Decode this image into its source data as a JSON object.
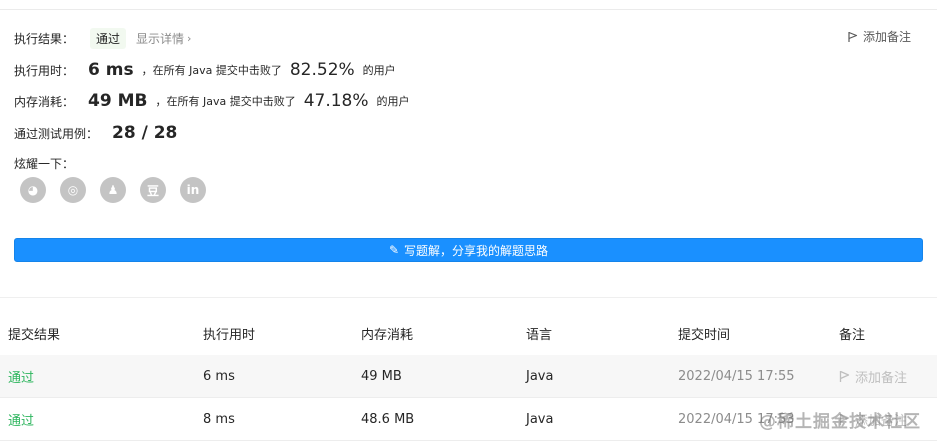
{
  "result": {
    "label": "执行结果：",
    "status": "通过",
    "details_link": "显示详情",
    "add_note": "添加备注"
  },
  "runtime": {
    "label": "执行用时：",
    "value": "6 ms",
    "prefix": "，在所有 Java 提交中击败了",
    "percent": "82.52%",
    "suffix": "的用户"
  },
  "memory": {
    "label": "内存消耗：",
    "value": "49 MB",
    "prefix": "，在所有 Java 提交中击败了",
    "percent": "47.18%",
    "suffix": "的用户"
  },
  "tests": {
    "label": "通过测试用例：",
    "value": "28 / 28"
  },
  "share": {
    "label": "炫耀一下：",
    "buttons": [
      {
        "icon": "wechat-icon",
        "glyph": "◕"
      },
      {
        "icon": "weibo-icon",
        "glyph": "◎"
      },
      {
        "icon": "qq-icon",
        "glyph": "♟"
      },
      {
        "icon": "douban-icon",
        "glyph": "豆"
      },
      {
        "icon": "linkedin-icon",
        "glyph": "in"
      }
    ]
  },
  "solution_button": "写题解，分享我的解题思路",
  "table": {
    "headers": [
      "提交结果",
      "执行用时",
      "内存消耗",
      "语言",
      "提交时间",
      "备注"
    ],
    "rows": [
      {
        "status": "通过",
        "runtime": "6 ms",
        "memory": "49 MB",
        "language": "Java",
        "time": "2022/04/15 17:55",
        "note": "添加备注"
      },
      {
        "status": "通过",
        "runtime": "8 ms",
        "memory": "48.6 MB",
        "language": "Java",
        "time": "2022/04/15 17:53",
        "note": "添加备注"
      }
    ]
  },
  "watermark": "@稀土掘金技术社区",
  "colors": {
    "accent": "#1a90ff",
    "pass": "#2db55d",
    "badge_bg": "#f2f9f0"
  }
}
